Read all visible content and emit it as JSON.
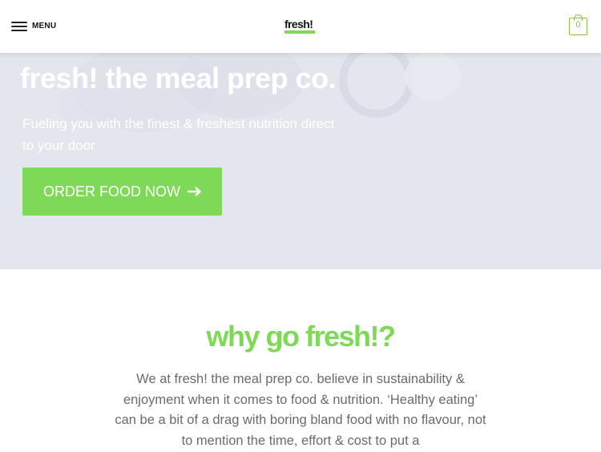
{
  "header": {
    "menu_label": "MENU",
    "logo_text": "fresh!",
    "cart_count": "0"
  },
  "hero": {
    "title": "fresh! the meal prep co.",
    "subtitle": "Fueling you with the finest & freshest nutrition direct to your door",
    "cta_label": "ORDER FOOD NOW"
  },
  "about": {
    "heading": "why go fresh!?",
    "body": "We at fresh! the meal prep co. believe in sustainability & enjoyment when it comes to food & nutrition. ‘Healthy eating’ can be a bit of a drag with boring bland food with no flavour, not to mention the time, effort & cost to put a"
  },
  "colors": {
    "accent": "#7ed957",
    "hero_background": "#e4e6ee",
    "body_text": "#6b6b6b"
  },
  "icons": {
    "menu": "hamburger-icon",
    "cart": "shopping-bag-icon",
    "cta": "arrow-right-icon"
  }
}
